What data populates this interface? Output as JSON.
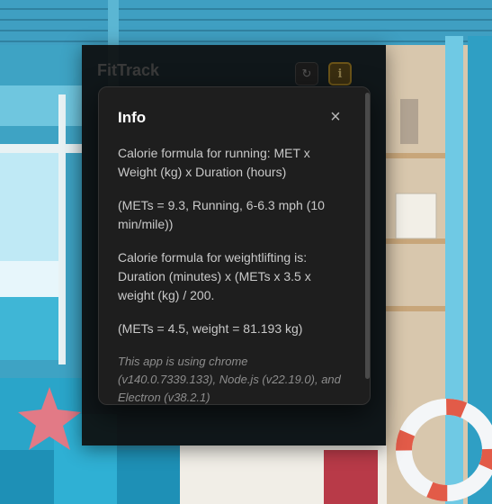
{
  "app": {
    "title": "FitTrack",
    "refresh_icon": "refresh-icon",
    "info_icon": "info-icon",
    "info_glyph": "i"
  },
  "modal": {
    "title": "Info",
    "close_glyph": "×",
    "paragraphs": [
      "Calorie formula for running: MET x Weight (kg) x Duration (hours)",
      "(METs = 9.3, Running, 6-6.3 mph (10 min/mile))",
      "Calorie formula for weightlifting is: Duration (minutes) x (METs x 3.5 x weight (kg) / 200.",
      "(METs = 4.5, weight = 81.193 kg)"
    ],
    "note": "This app is using chrome (v140.0.7339.133), Node.js (v22.19.0), and Electron (v38.2.1)"
  },
  "colors": {
    "window_bg": "#0e0e0e",
    "modal_bg": "#1e1e1e",
    "text": "#c9c9c9",
    "accent_info": "#6b5418"
  }
}
